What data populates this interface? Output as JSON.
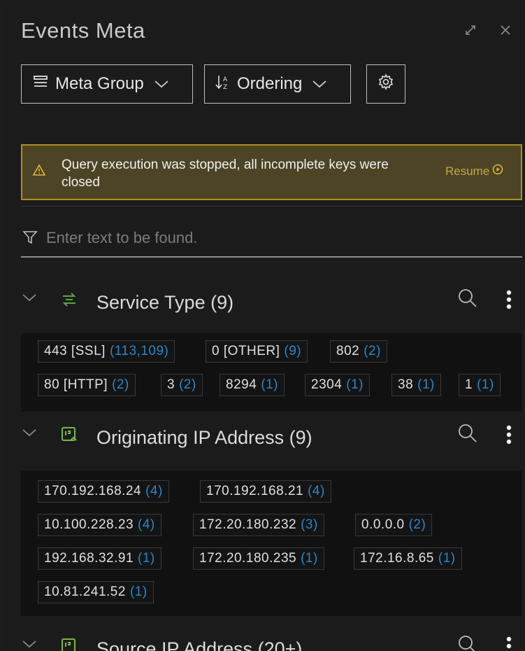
{
  "window": {
    "title": "Events Meta"
  },
  "toolbar": {
    "meta_group_label": "Meta Group",
    "ordering_label": "Ordering"
  },
  "alert": {
    "message": "Query execution was stopped, all incomplete keys were closed",
    "resume_label": "Resume",
    "color": "#b08e1f"
  },
  "filter": {
    "placeholder": "Enter text to be found."
  },
  "sections": [
    {
      "title": "Service Type (9)",
      "values": [
        {
          "label": "443 [SSL]",
          "count": "(113,109)"
        },
        {
          "label": "0 [OTHER]",
          "count": "(9)"
        },
        {
          "label": "802",
          "count": "(2)"
        },
        {
          "label": "80 [HTTP]",
          "count": "(2)"
        },
        {
          "label": "3",
          "count": "(2)"
        },
        {
          "label": "8294",
          "count": "(1)"
        },
        {
          "label": "2304",
          "count": "(1)"
        },
        {
          "label": "38",
          "count": "(1)"
        },
        {
          "label": "1",
          "count": "(1)"
        }
      ]
    },
    {
      "title": "Originating IP Address (9)",
      "values": [
        {
          "label": "170.192.168.24",
          "count": "(4)"
        },
        {
          "label": "170.192.168.21",
          "count": "(4)"
        },
        {
          "label": "10.100.228.23",
          "count": "(4)"
        },
        {
          "label": "172.20.180.232",
          "count": "(3)"
        },
        {
          "label": "0.0.0.0",
          "count": "(2)"
        },
        {
          "label": "192.168.32.91",
          "count": "(1)"
        },
        {
          "label": "172.20.180.235",
          "count": "(1)"
        },
        {
          "label": "172.16.8.65",
          "count": "(1)"
        },
        {
          "label": "10.81.241.52",
          "count": "(1)"
        }
      ]
    },
    {
      "title": "Source IP Address (20+)"
    }
  ],
  "colors": {
    "accent": "#2b86c8",
    "service_icon": "#5aa83b",
    "ip_icon": "#78b84a",
    "background": "#1b1b1b"
  }
}
